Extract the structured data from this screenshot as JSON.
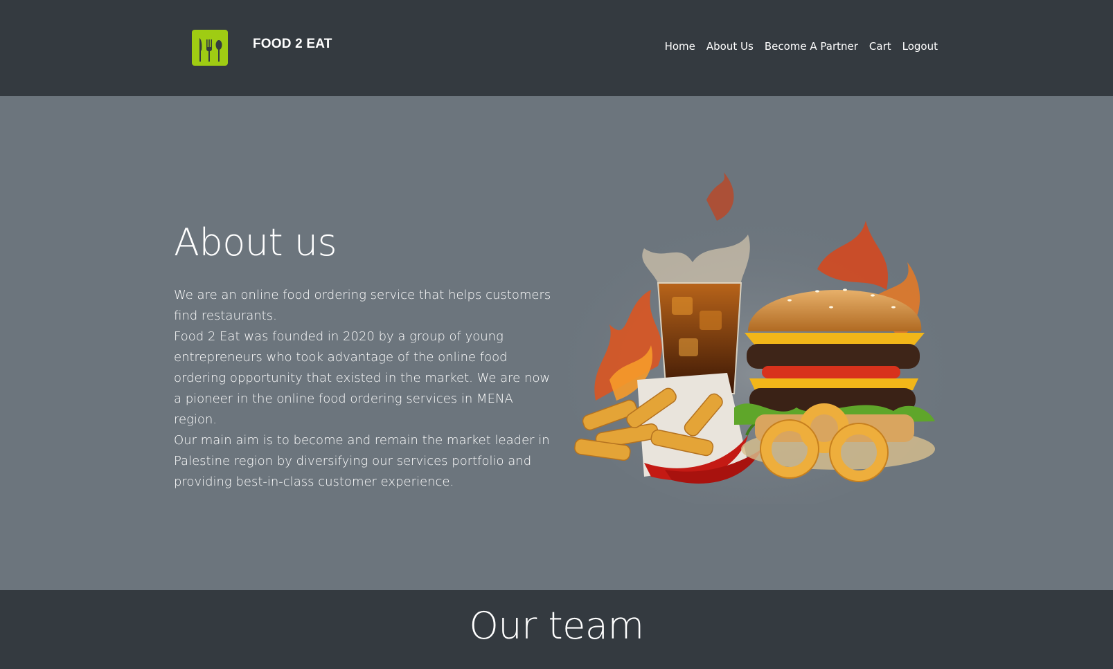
{
  "brand": {
    "name": "FOOD 2 EAT",
    "logo_icon": "fork-knife-spoon-icon",
    "accent_color": "#9fcc13"
  },
  "nav": {
    "items": [
      "Home",
      "About Us",
      "Become A Partner",
      "Cart",
      "Logout"
    ]
  },
  "about": {
    "title": "About us",
    "paragraphs": [
      "We are an online food ordering service that helps customers find restaurants.",
      "Food 2 Eat was founded in 2020 by a group of young entrepreneurs who took advantage of the online food ordering opportunity that existed in the market. We are now a pioneer in the online food ordering services in MENA region.",
      "Our main aim is to become and remain the market leader in Palestine region by diversifying our services portfolio and providing best-in-class customer experience."
    ],
    "image_icon": "burger-fries-drink-illustration"
  },
  "team": {
    "title": "Our team"
  },
  "colors": {
    "navbar_bg": "#343a40",
    "about_bg": "#6c757d",
    "text": "#ffffff"
  }
}
